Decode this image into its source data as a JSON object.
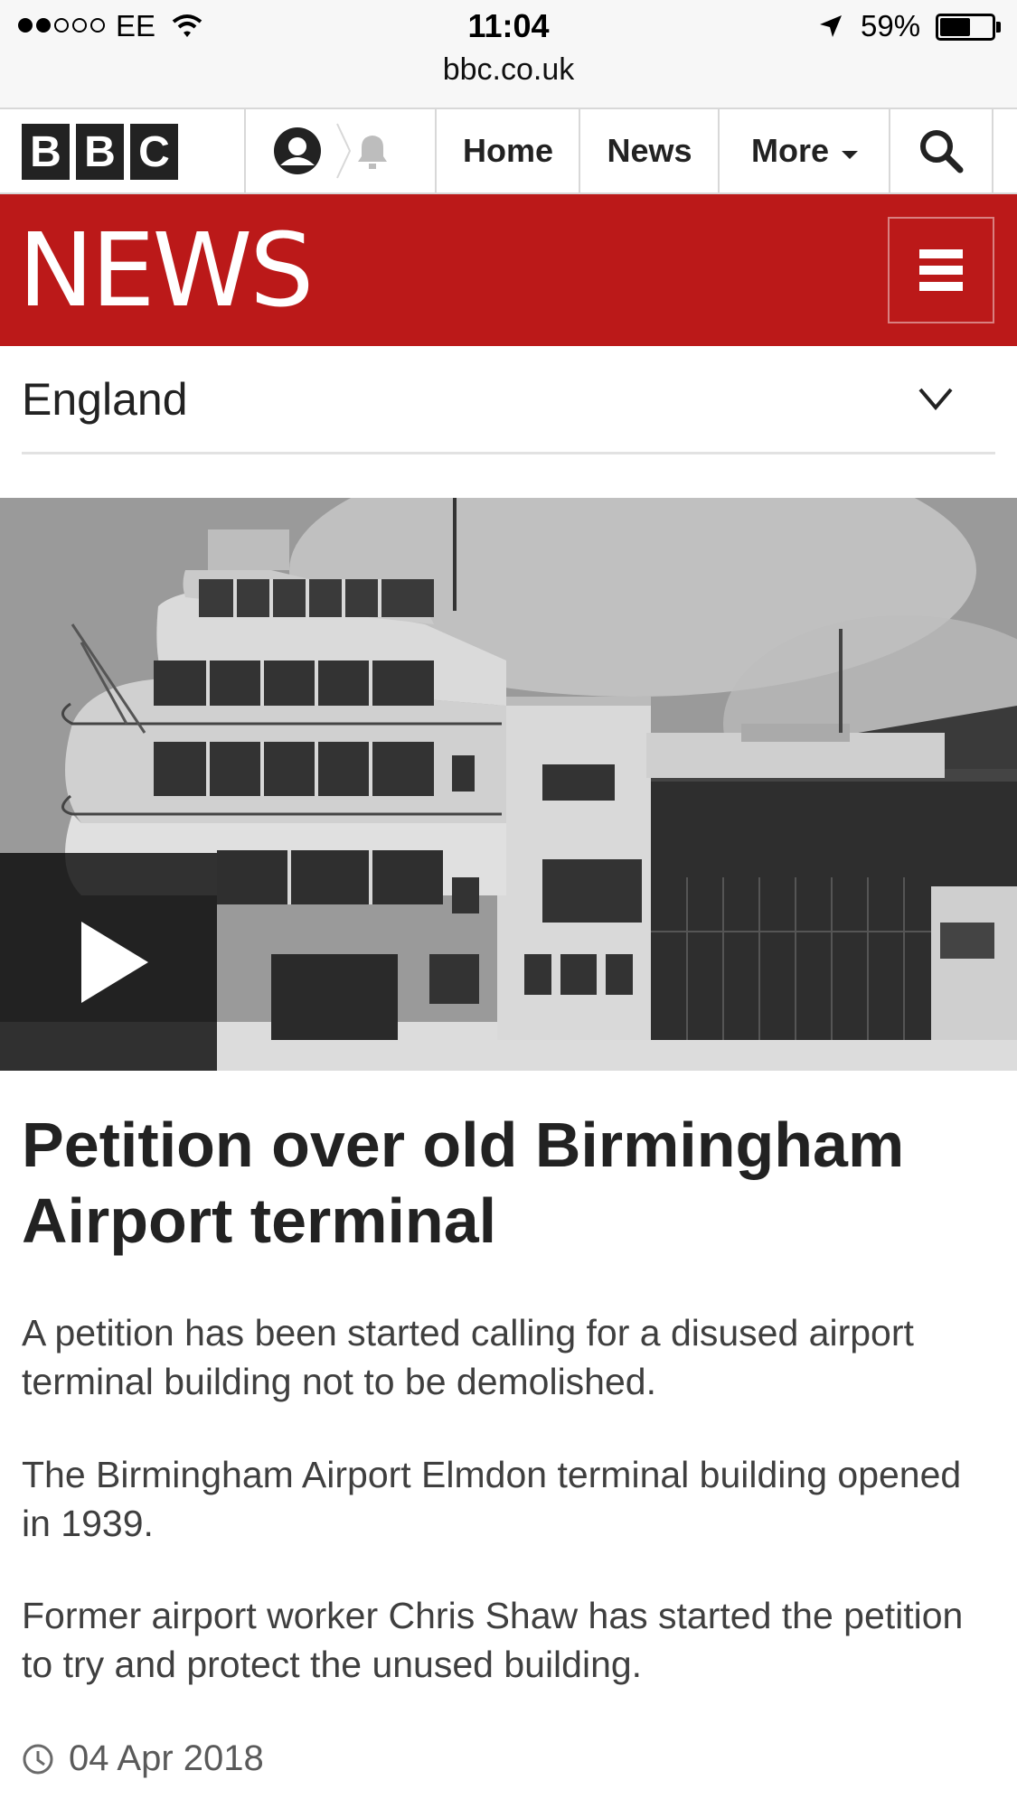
{
  "status_bar": {
    "carrier": "EE",
    "time": "11:04",
    "battery_percent": "59%",
    "battery_level": 0.59,
    "signal_bars": 2,
    "signal_total": 5
  },
  "browser": {
    "url": "bbc.co.uk"
  },
  "bbc_nav": {
    "logo_letters": [
      "B",
      "B",
      "C"
    ],
    "items": [
      {
        "label": "Home"
      },
      {
        "label": "News"
      },
      {
        "label": "More"
      }
    ],
    "account_icon": "account-icon",
    "notifications_icon": "bell-icon",
    "search_icon": "search-icon"
  },
  "banner": {
    "title": "NEWS",
    "color": "#bb1919",
    "menu_icon": "hamburger-icon"
  },
  "section": {
    "label": "England",
    "icon": "chevron-down-icon"
  },
  "article": {
    "video_icon": "play-icon",
    "headline": "Petition over old Birmingham Airport terminal",
    "paragraphs": [
      "A petition has been started calling for a disused airport terminal building not to be demolished.",
      "The Birmingham Airport Elmdon terminal building opened in 1939.",
      "Former airport worker Chris Shaw has started the petition to try and protect the unused building."
    ],
    "date": "04 Apr 2018",
    "date_icon": "clock-icon"
  }
}
